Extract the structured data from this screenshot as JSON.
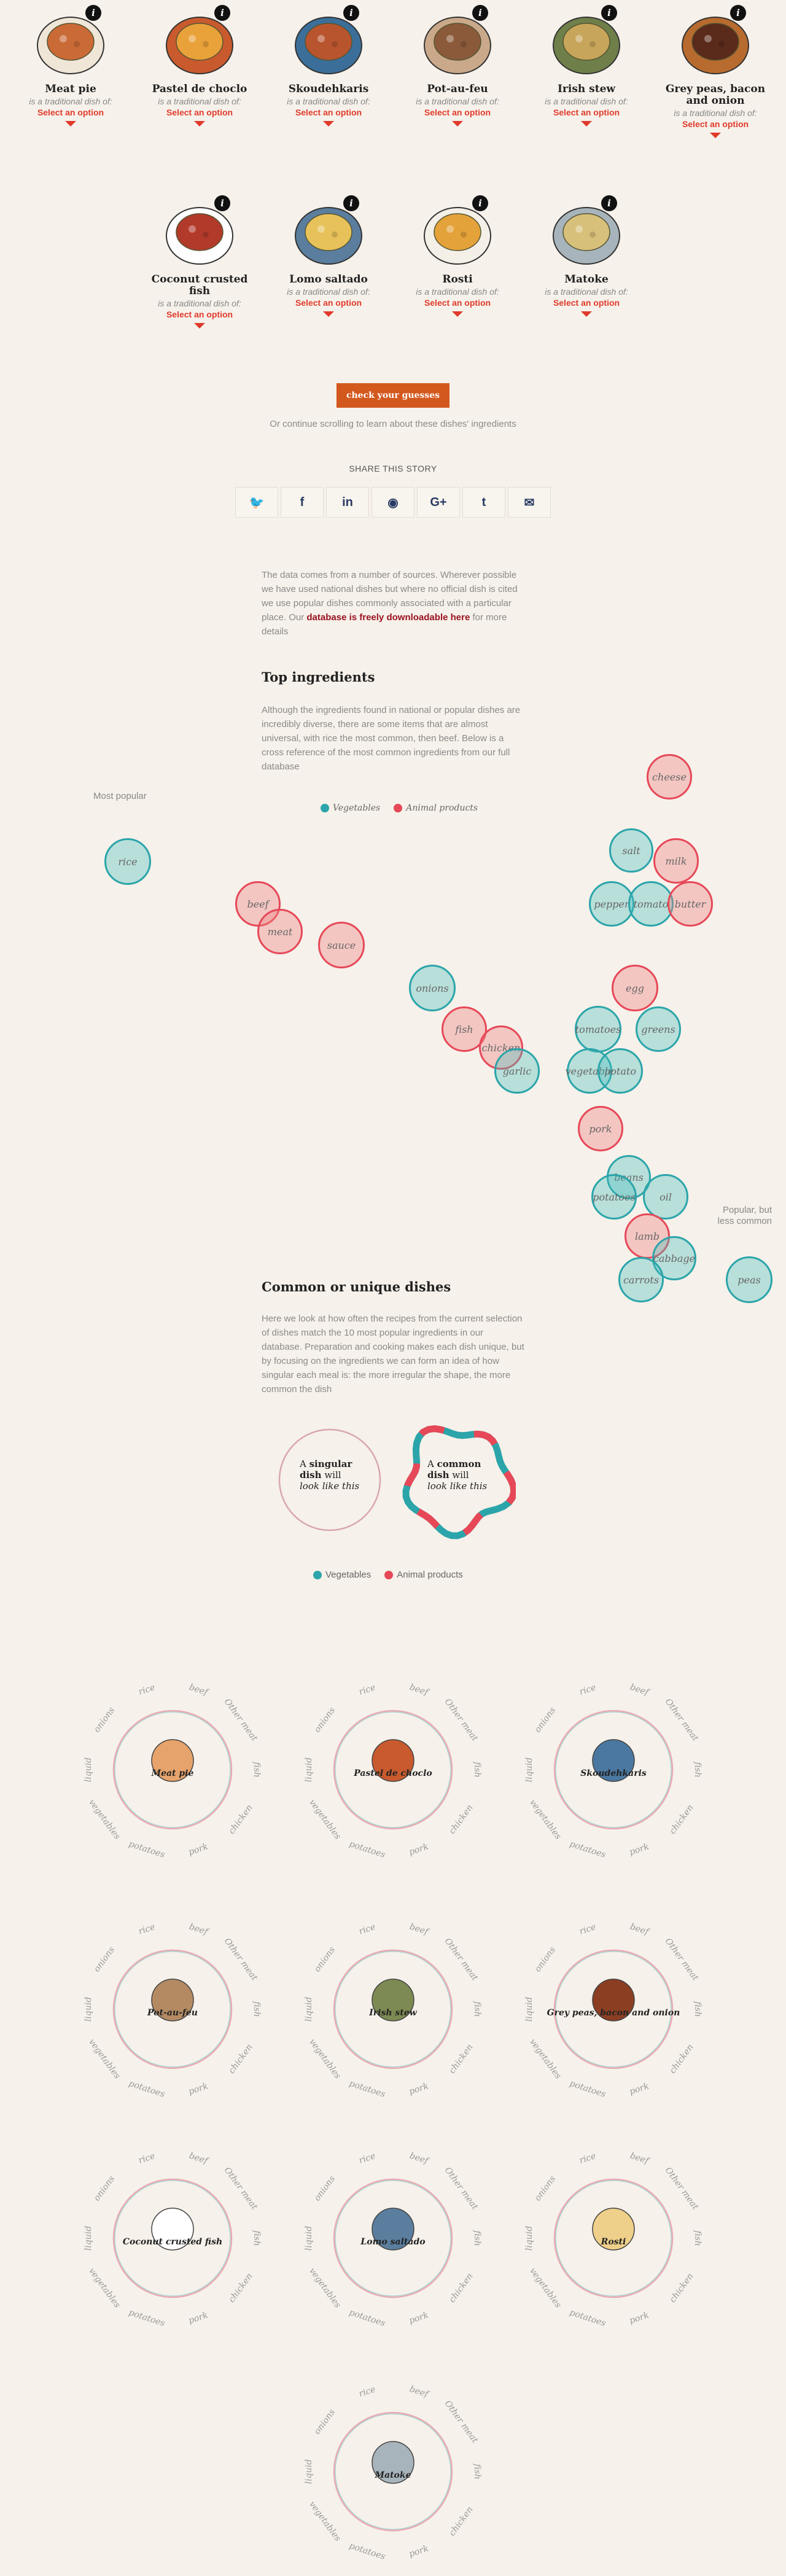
{
  "picker": {
    "dishes": [
      {
        "name": "Meat pie",
        "sub": "is a traditional dish of:",
        "select": "Select an option"
      },
      {
        "name": "Pastel de choclo",
        "sub": "is a traditional dish of:",
        "select": "Select an option"
      },
      {
        "name": "Skoudehkaris",
        "sub": "is a traditional dish of:",
        "select": "Select an option"
      },
      {
        "name": "Pot-au-feu",
        "sub": "is a traditional dish of:",
        "select": "Select an option"
      },
      {
        "name": "Irish stew",
        "sub": "is a traditional dish of:",
        "select": "Select an option"
      },
      {
        "name": "Grey peas, bacon and onion",
        "sub": "is a traditional dish of:",
        "select": "Select an option"
      },
      {
        "name": "Coconut crusted fish",
        "sub": "is a traditional dish of:",
        "select": "Select an option"
      },
      {
        "name": "Lomo saltado",
        "sub": "is a traditional dish of:",
        "select": "Select an option"
      },
      {
        "name": "Rosti",
        "sub": "is a traditional dish of:",
        "select": "Select an option"
      },
      {
        "name": "Matoke",
        "sub": "is a traditional dish of:",
        "select": "Select an option"
      }
    ],
    "info_glyph": "i",
    "check_button": "check your guesses",
    "continue_text": "Or continue scrolling to learn about these dishes' ingredients"
  },
  "share": {
    "title": "SHARE THIS STORY",
    "buttons": [
      {
        "icon": "twitter-icon",
        "glyph": "🐦"
      },
      {
        "icon": "facebook-icon",
        "glyph": "f"
      },
      {
        "icon": "linkedin-icon",
        "glyph": "in"
      },
      {
        "icon": "reddit-icon",
        "glyph": "◉"
      },
      {
        "icon": "google-plus-icon",
        "glyph": "G+"
      },
      {
        "icon": "tumblr-icon",
        "glyph": "t"
      },
      {
        "icon": "email-icon",
        "glyph": "✉"
      }
    ]
  },
  "sources": {
    "text_before": "The data comes from a number of sources. Wherever possible we have used national dishes but where no official dish is cited we use popular dishes commonly associated with a particular place. Our ",
    "link": "database is freely downloadable here",
    "text_after": " for more details"
  },
  "top_ingredients": {
    "title": "Top ingredients",
    "text": "Although the ingredients found in national or popular dishes are incredibly diverse, there are some items that are almost universal, with rice the most common, then beef. Below is a cross reference of the most common ingredients from our full database",
    "legend_veg": "Vegetables",
    "legend_animal": "Animal products",
    "most_popular": "Most popular",
    "less_common": "Popular, but less common",
    "bubbles": [
      {
        "label": "cheese",
        "type": "ani"
      },
      {
        "label": "rice",
        "type": "veg"
      },
      {
        "label": "salt",
        "type": "veg"
      },
      {
        "label": "milk",
        "type": "ani"
      },
      {
        "label": "beef",
        "type": "ani"
      },
      {
        "label": "pepper",
        "type": "veg"
      },
      {
        "label": "tomato",
        "type": "veg"
      },
      {
        "label": "butter",
        "type": "ani"
      },
      {
        "label": "meat",
        "type": "ani"
      },
      {
        "label": "sauce",
        "type": "ani"
      },
      {
        "label": "onions",
        "type": "veg"
      },
      {
        "label": "egg",
        "type": "ani"
      },
      {
        "label": "fish",
        "type": "ani"
      },
      {
        "label": "tomatoes",
        "type": "veg"
      },
      {
        "label": "greens",
        "type": "veg"
      },
      {
        "label": "chicken",
        "type": "ani"
      },
      {
        "label": "garlic",
        "type": "veg"
      },
      {
        "label": "vegetable",
        "type": "veg"
      },
      {
        "label": "potato",
        "type": "veg"
      },
      {
        "label": "pork",
        "type": "ani"
      },
      {
        "label": "beans",
        "type": "veg"
      },
      {
        "label": "potatoes",
        "type": "veg"
      },
      {
        "label": "oil",
        "type": "veg"
      },
      {
        "label": "lamb",
        "type": "ani"
      },
      {
        "label": "cabbage",
        "type": "veg"
      },
      {
        "label": "carrots",
        "type": "veg"
      },
      {
        "label": "peas",
        "type": "veg"
      }
    ]
  },
  "common_unique": {
    "title": "Common or unique dishes",
    "text": "Here we look at how often the recipes from the current selection of dishes match the 10 most popular ingredients in our database. Preparation and cooking makes each dish unique, but by focusing on the ingredients we can form an idea of how singular each meal is: the more irregular the shape, the more common the dish",
    "singular_a": "A ",
    "singular_b": "singular dish",
    "singular_c": " will ",
    "singular_d": "look like this",
    "common_a": "A ",
    "common_b": "common dish",
    "common_c": " will ",
    "common_d": "look like this",
    "legend_veg": "Vegetables",
    "legend_animal": "Animal products",
    "axis_labels": [
      "rice",
      "beef",
      "Other meat",
      "fish",
      "chicken",
      "pork",
      "potatoes",
      "vegetables",
      "liquid",
      "onions"
    ],
    "dishes": [
      "Meat pie",
      "Pastel de choclo",
      "Skoudehkaris",
      "Pot-au-feu",
      "Irish stew",
      "Grey peas, bacon and onion",
      "Coconut crusted fish",
      "Lomo saltado",
      "Rosti",
      "Matoke"
    ]
  },
  "colors": {
    "veg": "#2ba5aa",
    "animal": "#e64858",
    "accent": "#d3581e",
    "select": "#e03a2b"
  }
}
